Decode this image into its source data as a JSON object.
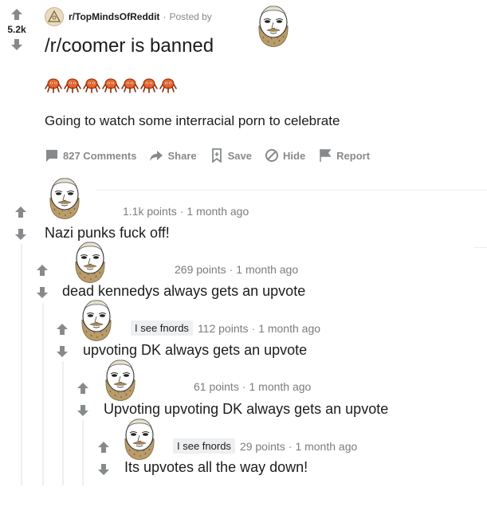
{
  "post": {
    "score": "5.2k",
    "subreddit": "r/TopMindsOfReddit",
    "posted_by": "Posted by",
    "meta_sep": "·",
    "title": "/r/coomer is banned",
    "awards_count": 7,
    "body": "Going to watch some interracial porn to celebrate",
    "actions": {
      "comments": "827 Comments",
      "share": "Share",
      "save": "Save",
      "hide": "Hide",
      "report": "Report"
    },
    "colors": {
      "award": "#e8652c",
      "icon_gray": "#878a8c"
    }
  },
  "comments": [
    {
      "flair": "",
      "points": "1.1k points",
      "sep": "·",
      "time": "1 month ago",
      "body": "Nazi punks fuck off!"
    },
    {
      "flair": "",
      "points": "269 points",
      "sep": "·",
      "time": "1 month ago",
      "body": "dead kennedys always gets an upvote"
    },
    {
      "flair": "I see fnords",
      "points": "112 points",
      "sep": "·",
      "time": "1 month ago",
      "body": "upvoting DK always gets an upvote"
    },
    {
      "flair": "",
      "points": "61 points",
      "sep": "·",
      "time": "1 month ago",
      "body": "Upvoting upvoting DK always gets an upvote"
    },
    {
      "flair": "I see fnords",
      "points": "29 points",
      "sep": "·",
      "time": "1 month ago",
      "body": "Its upvotes all the way down!"
    }
  ]
}
